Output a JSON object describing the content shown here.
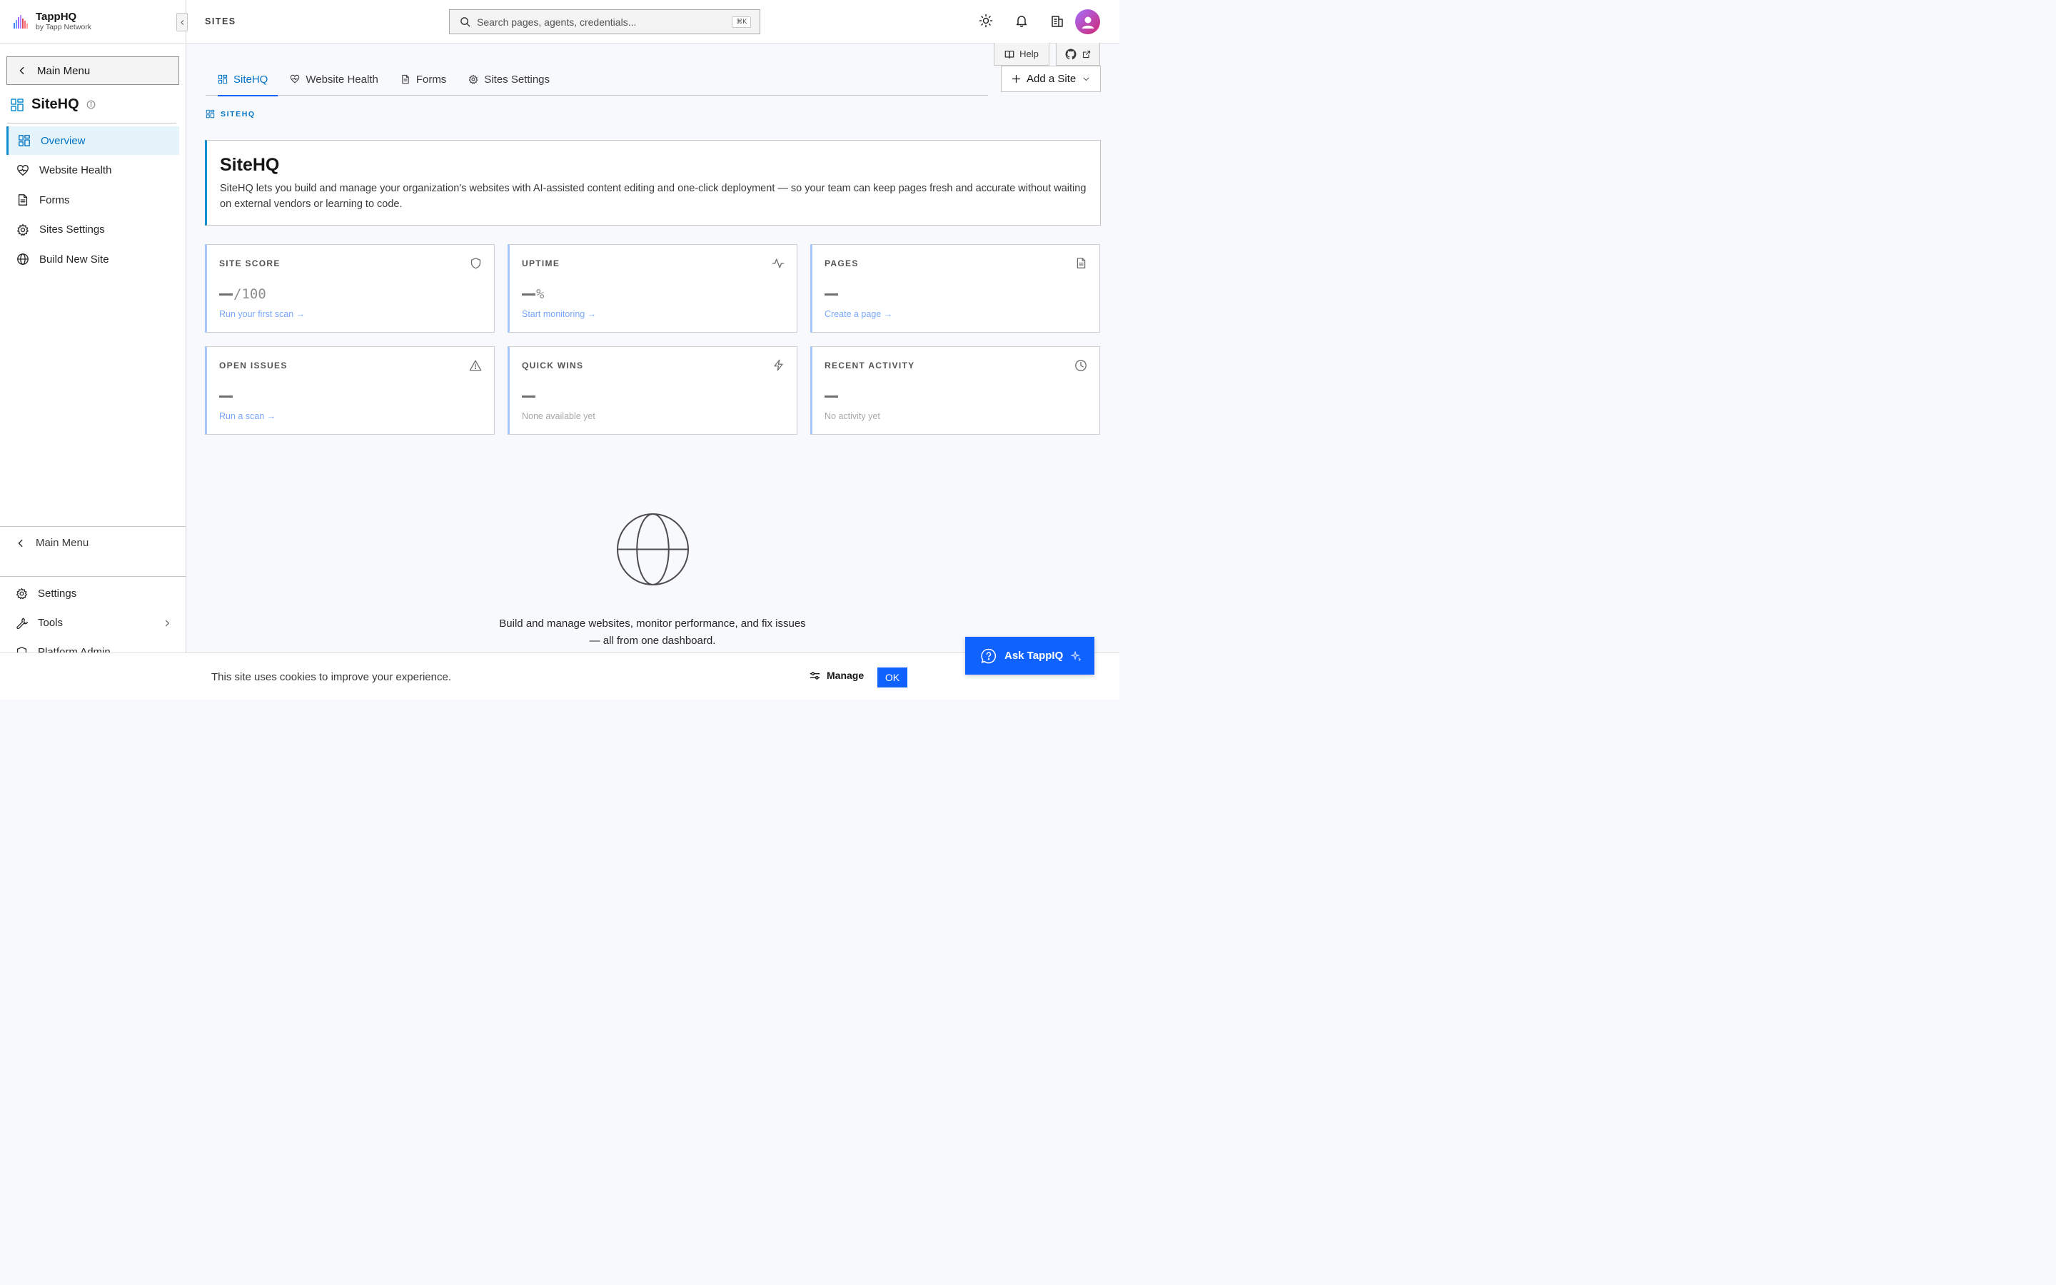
{
  "brand": {
    "name": "TappHQ",
    "sub": "by Tapp Network"
  },
  "sidebar": {
    "main_menu_label": "Main Menu",
    "section_title": "SiteHQ",
    "items": [
      {
        "label": "Overview",
        "icon": "dashboard-icon",
        "active": true
      },
      {
        "label": "Website Health",
        "icon": "heart-pulse-icon"
      },
      {
        "label": "Forms",
        "icon": "document-icon"
      },
      {
        "label": "Sites Settings",
        "icon": "gear-icon"
      },
      {
        "label": "Build New Site",
        "icon": "globe-icon"
      }
    ],
    "bottom": {
      "main_menu": "Main Menu",
      "settings": "Settings",
      "tools": "Tools",
      "platform_admin": "Platform Admin"
    }
  },
  "topbar": {
    "label": "SITES",
    "search_placeholder": "Search pages, agents, credentials...",
    "shortcut": "⌘K"
  },
  "actions": {
    "help": "Help",
    "add_site": "Add a Site"
  },
  "tabs": [
    {
      "label": "SiteHQ",
      "active": true
    },
    {
      "label": "Website Health"
    },
    {
      "label": "Forms"
    },
    {
      "label": "Sites Settings"
    }
  ],
  "breadcrumb": "SITEHQ",
  "intro": {
    "title": "SiteHQ",
    "description": "SiteHQ lets you build and manage your organization's websites with AI-assisted content editing and one-click deployment — so your team can keep pages fresh and accurate without waiting on external vendors or learning to code."
  },
  "cards": [
    {
      "label": "SITE SCORE",
      "suffix": "/100",
      "link": "Run your first scan →",
      "icon": "shield-icon"
    },
    {
      "label": "UPTIME",
      "suffix": "%",
      "link": "Start monitoring →",
      "icon": "activity-icon"
    },
    {
      "label": "PAGES",
      "suffix": "",
      "link": "Create a page →",
      "icon": "document-icon"
    },
    {
      "label": "OPEN ISSUES",
      "suffix": "",
      "link": "Run a scan →",
      "icon": "warning-icon"
    },
    {
      "label": "QUICK WINS",
      "suffix": "",
      "note": "None available yet",
      "icon": "lightning-icon"
    },
    {
      "label": "RECENT ACTIVITY",
      "suffix": "",
      "note": "No activity yet",
      "icon": "clock-icon"
    }
  ],
  "empty_state": {
    "line1": "Build and manage websites, monitor performance, and fix issues",
    "line2": "— all from one dashboard."
  },
  "cookie": {
    "text": "This site uses cookies to improve your experience.",
    "manage": "Manage",
    "ok": "OK"
  },
  "ask_button": "Ask TappIQ",
  "colors": {
    "accent": "#0f62fe",
    "active_bg": "#e5f3fb",
    "sidebar_active_border": "#0f8dd1",
    "card_border_left": "#a6c8ff",
    "link": "#78a9ff"
  }
}
